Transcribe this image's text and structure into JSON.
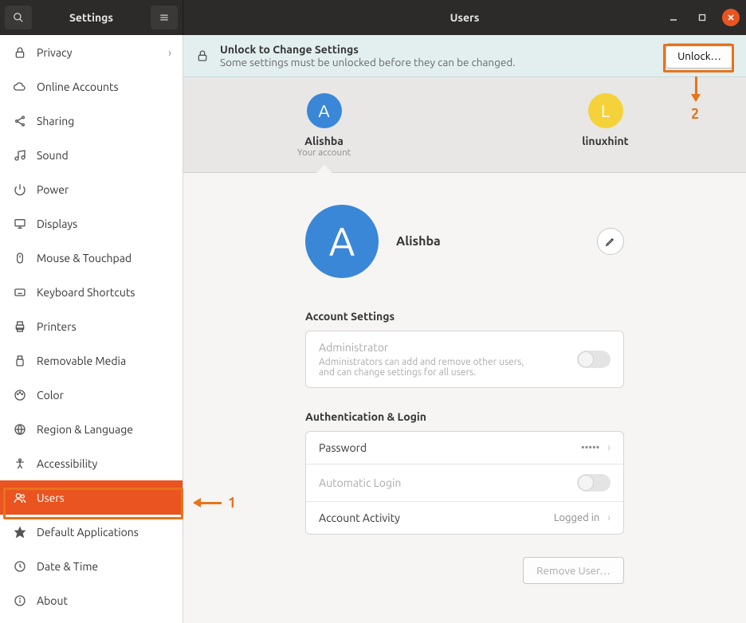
{
  "titlebar": {
    "left_title": "Settings",
    "right_title": "Users"
  },
  "sidebar": {
    "items": [
      {
        "label": "Privacy",
        "icon": "lock",
        "chevron": true
      },
      {
        "label": "Online Accounts",
        "icon": "cloud"
      },
      {
        "label": "Sharing",
        "icon": "share"
      },
      {
        "label": "Sound",
        "icon": "music"
      },
      {
        "label": "Power",
        "icon": "power"
      },
      {
        "label": "Displays",
        "icon": "display"
      },
      {
        "label": "Mouse & Touchpad",
        "icon": "mouse"
      },
      {
        "label": "Keyboard Shortcuts",
        "icon": "keyboard"
      },
      {
        "label": "Printers",
        "icon": "printer"
      },
      {
        "label": "Removable Media",
        "icon": "usb"
      },
      {
        "label": "Color",
        "icon": "palette"
      },
      {
        "label": "Region & Language",
        "icon": "globe"
      },
      {
        "label": "Accessibility",
        "icon": "accessibility"
      },
      {
        "label": "Users",
        "icon": "users",
        "active": true
      },
      {
        "label": "Default Applications",
        "icon": "star"
      },
      {
        "label": "Date & Time",
        "icon": "clock"
      },
      {
        "label": "About",
        "icon": "info"
      }
    ]
  },
  "infobar": {
    "title": "Unlock to Change Settings",
    "subtitle": "Some settings must be unlocked before they can be changed.",
    "button": "Unlock…"
  },
  "users": [
    {
      "name": "Alishba",
      "initial": "A",
      "color": "blue",
      "subtitle": "Your account",
      "selected": true
    },
    {
      "name": "linuxhint",
      "initial": "L",
      "color": "yellow",
      "selected": false
    }
  ],
  "detail": {
    "name": "Alishba",
    "initial": "A",
    "sections": {
      "account_title": "Account Settings",
      "admin_label": "Administrator",
      "admin_desc": "Administrators can add and remove other users, and can change settings for all users.",
      "auth_title": "Authentication & Login",
      "password_label": "Password",
      "password_value": "•••••",
      "autologin_label": "Automatic Login",
      "activity_label": "Account Activity",
      "activity_value": "Logged in"
    },
    "remove_button": "Remove User…"
  },
  "annotations": {
    "one": "1",
    "two": "2"
  }
}
